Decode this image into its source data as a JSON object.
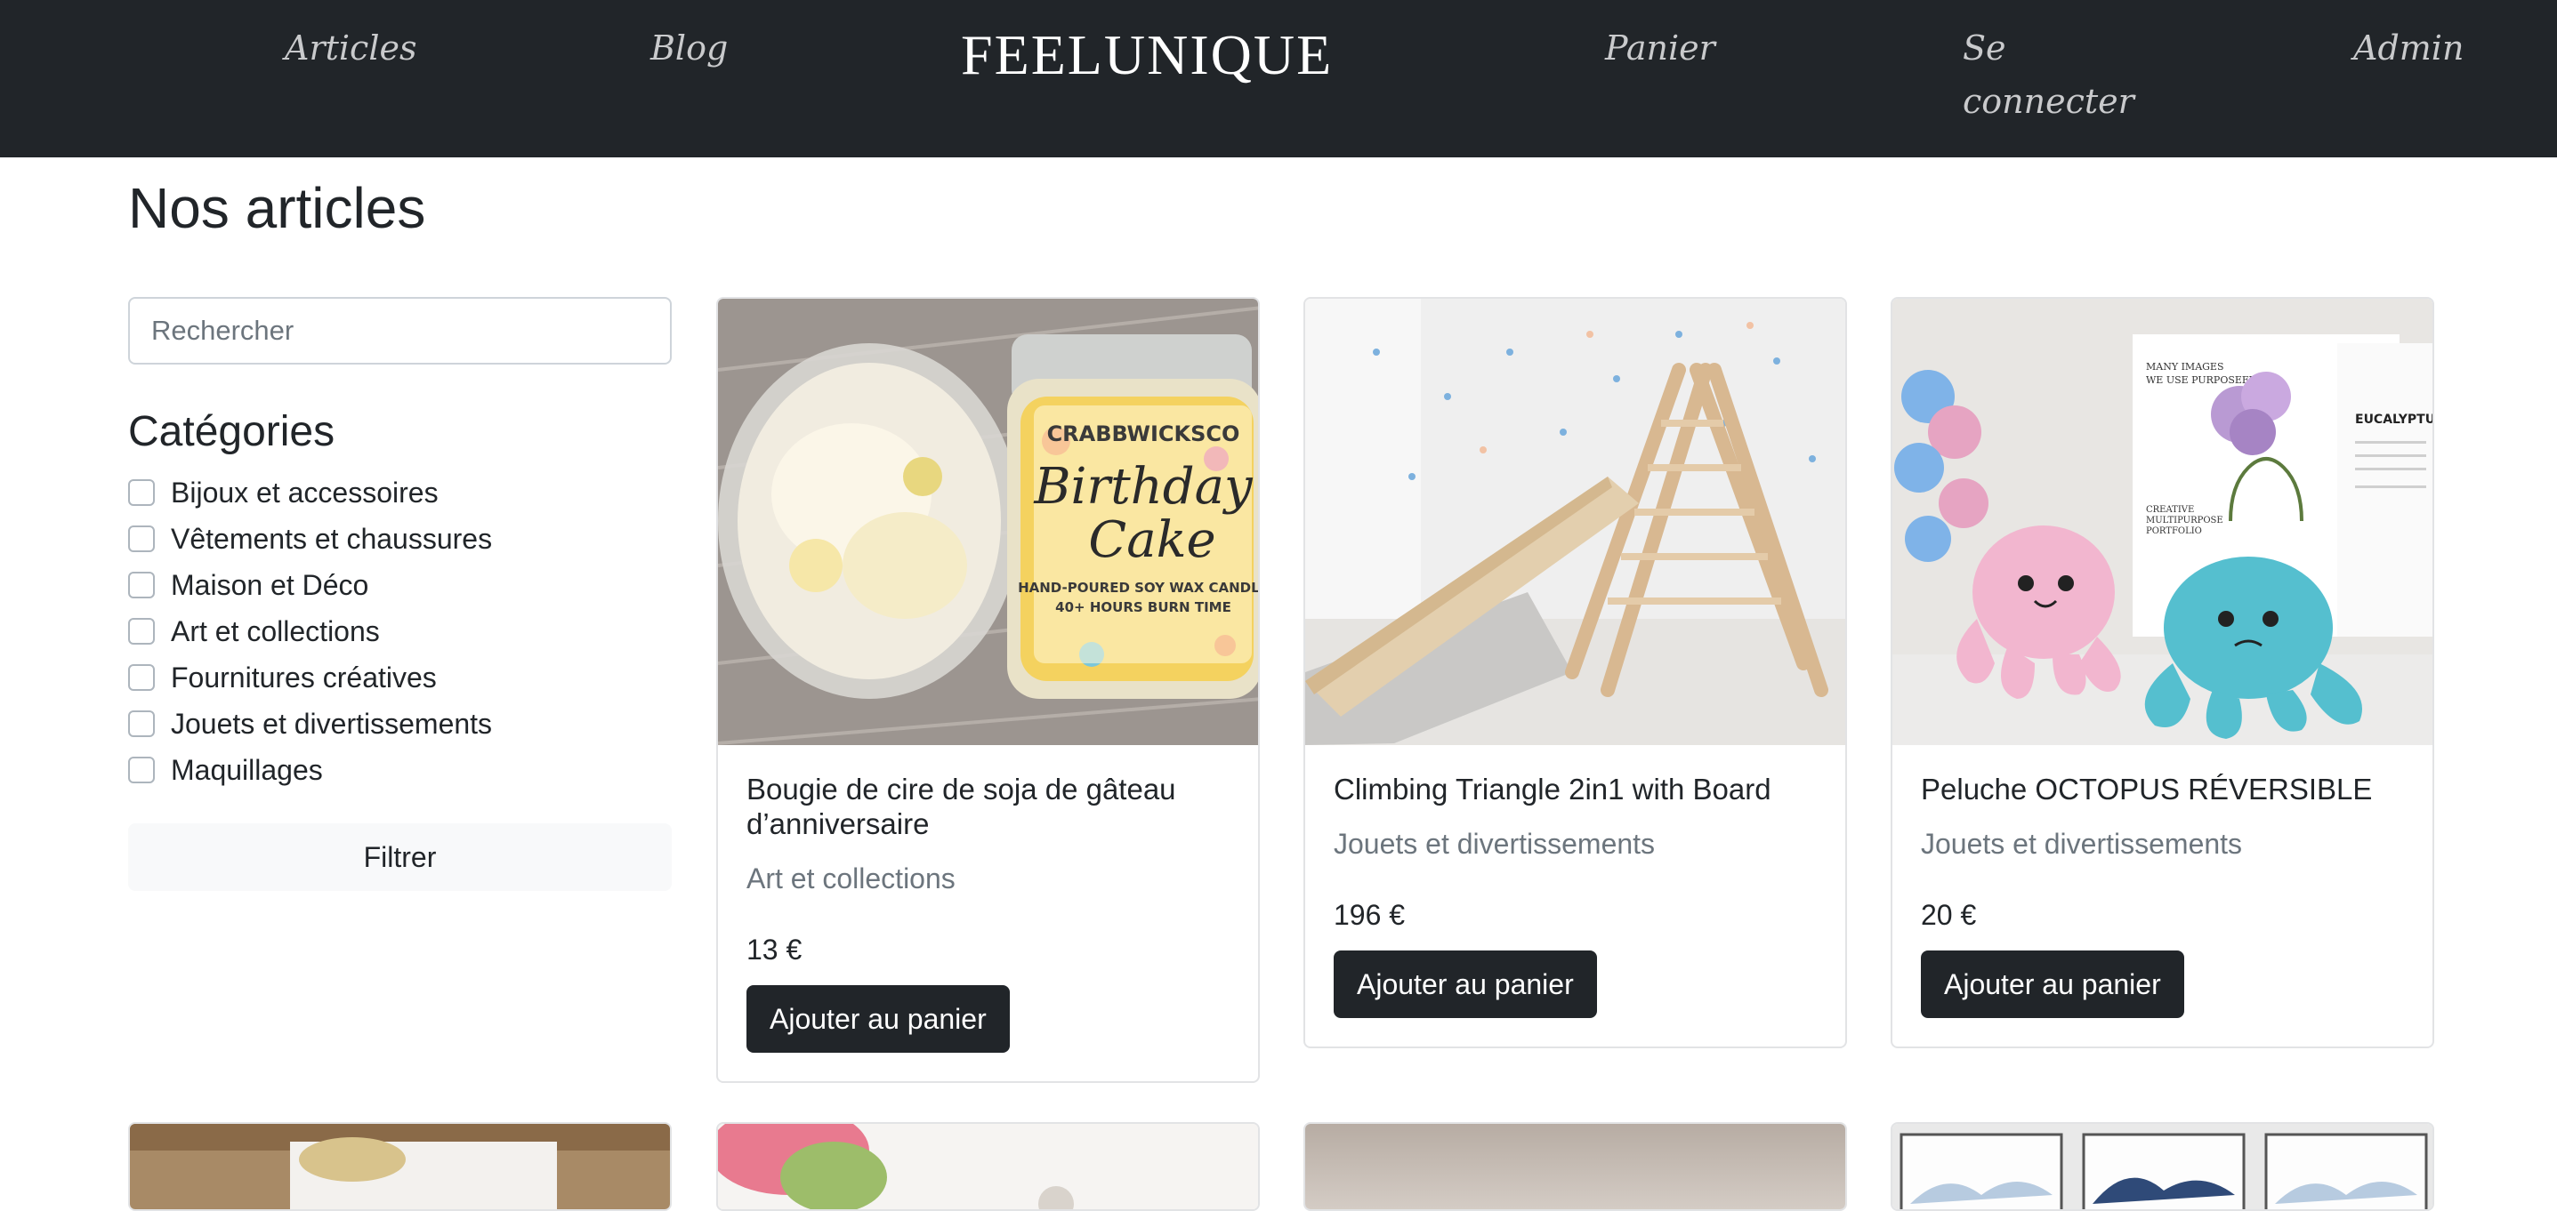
{
  "nav": {
    "brand": "FEELUNIQUE",
    "links": [
      "Articles",
      "Blog",
      "Panier",
      "Se connecter",
      "Admin"
    ]
  },
  "page_title": "Nos articles",
  "search": {
    "placeholder": "Rechercher",
    "value": ""
  },
  "categories": {
    "title": "Catégories",
    "items": [
      "Bijoux et accessoires",
      "Vêtements et chaussures",
      "Maison et Déco",
      "Art et collections",
      "Fournitures créatives",
      "Jouets et divertissements",
      "Maquillages"
    ]
  },
  "filter_button": "Filtrer",
  "products": [
    {
      "title": "Bougie de cire de soja de gâteau d’anniversaire",
      "category": "Art et collections",
      "price": "13 €",
      "button": "Ajouter au panier"
    },
    {
      "title": "Climbing Triangle 2in1 with Board",
      "category": "Jouets et divertissements",
      "price": "196 €",
      "button": "Ajouter au panier"
    },
    {
      "title": "Peluche OCTOPUS RÉVERSIBLE",
      "category": "Jouets et divertissements",
      "price": "20 €",
      "button": "Ajouter au panier"
    }
  ],
  "image_text": {
    "candle_brand": "CRABBWICKSCO",
    "candle_name_1": "Birthday",
    "candle_name_2": "Cake",
    "candle_sub_1": "HAND-POURED SOY WAX CANDLE",
    "candle_sub_2": "40+ HOURS BURN TIME",
    "book_1": "MANY IMAGES",
    "book_2": "WE USE PURPOSEFULLY",
    "book_3": "CREATIVE",
    "book_4": "MULTIPURPOSE",
    "book_5": "PORTFOLIO",
    "book_6": "EUCALYPTU"
  },
  "colors": {
    "navbar": "#212529",
    "nav_link": "#c9cacc",
    "muted": "#6c757d",
    "button_dark": "#212529"
  }
}
